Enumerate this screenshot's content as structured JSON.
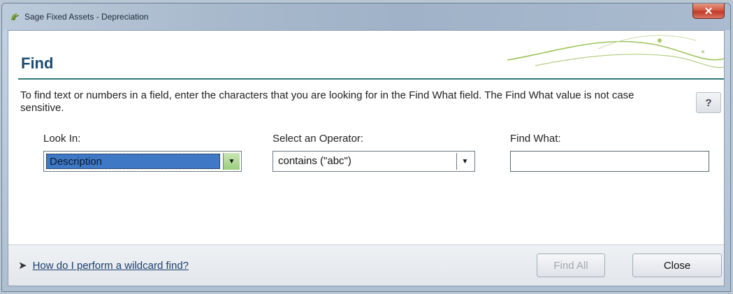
{
  "window": {
    "title": "Sage Fixed Assets - Depreciation",
    "close_glyph": "✕"
  },
  "dialog": {
    "heading": "Find",
    "instructions": "To find text or numbers in a field, enter the characters that you are looking for in the Find What field. The Find What value is not case sensitive.",
    "help_label": "?"
  },
  "fields": {
    "look_in": {
      "label": "Look In:",
      "value": "Description"
    },
    "operator": {
      "label": "Select an Operator:",
      "value": "contains (\"abc\")"
    },
    "find_what": {
      "label": "Find What:",
      "value": ""
    }
  },
  "footer": {
    "link_prefix": "➤",
    "link_text": "How do I perform a wildcard find?",
    "find_all_label": "Find All",
    "close_label": "Close"
  },
  "icons": {
    "app": "sage-app-icon",
    "dropdown": "chevron-down-icon",
    "close": "close-icon"
  },
  "colors": {
    "heading": "#1c4b73",
    "accent_rule": "#2f7a78",
    "selection": "#3f78c4",
    "close_button": "#c0392b"
  }
}
